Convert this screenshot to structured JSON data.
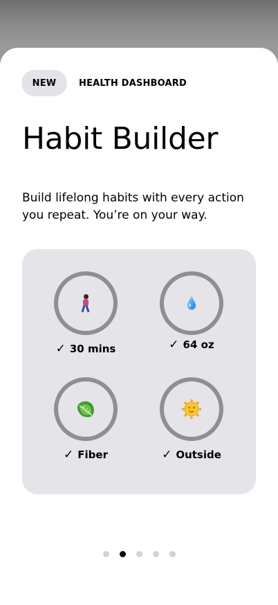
{
  "header": {
    "badge": "NEW",
    "category": "HEALTH DASHBOARD"
  },
  "title": "Habit Builder",
  "subtitle": "Build lifelong habits with every action you repeat. You’re on your way.",
  "habits": [
    {
      "icon": "walking-person-icon",
      "check": "✓",
      "label": "30 mins"
    },
    {
      "icon": "water-drop-icon",
      "check": "✓",
      "label": "64 oz"
    },
    {
      "icon": "leafy-green-icon",
      "check": "✓",
      "label": "Fiber"
    },
    {
      "icon": "sun-face-icon",
      "check": "✓",
      "label": "Outside"
    }
  ],
  "pagination": {
    "total": 5,
    "active_index": 1
  },
  "colors": {
    "ring": "#8e8e93",
    "card": "#e4e4e9",
    "badge": "#e3e3e8",
    "dot_inactive": "#d1d1d6",
    "dot_active": "#000000"
  }
}
